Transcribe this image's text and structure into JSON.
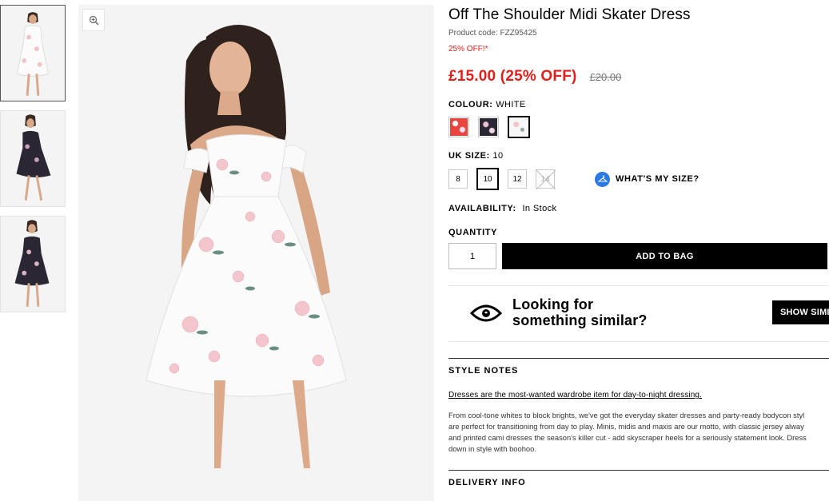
{
  "product": {
    "title": "Off The Shoulder Midi Skater Dress",
    "product_code": "Product code: FZZ95425",
    "discount_note": "25% OFF!*",
    "price_now": "£15.00 (25% OFF)",
    "price_was": "£20.00"
  },
  "colour": {
    "label": "COLOUR:",
    "value": "WHITE",
    "swatches": [
      {
        "name": "red-floral",
        "color": "#e8463c"
      },
      {
        "name": "black-floral",
        "color": "#2a2633"
      },
      {
        "name": "white-floral",
        "color": "#f2f2f2"
      }
    ],
    "selected_index": 2
  },
  "size": {
    "label": "UK SIZE:",
    "value": "10",
    "options": [
      "8",
      "10",
      "12",
      "14"
    ],
    "selected": "10",
    "out_of_stock": [
      "14"
    ],
    "guide_label": "WHAT'S MY SIZE?"
  },
  "availability": {
    "label": "AVAILABILITY:",
    "value": "In Stock"
  },
  "quantity": {
    "label": "QUANTITY",
    "value": "1"
  },
  "actions": {
    "add_to_bag": "ADD TO BAG"
  },
  "similar": {
    "line1": "Looking for",
    "line2": "something similar?",
    "button": "SHOW SIMI"
  },
  "style_notes": {
    "heading": "STYLE NOTES",
    "lead": "Dresses are the most-wanted wardrobe item for day-to-night dressing.",
    "body_lines": [
      "From cool-tone whites to block brights, we've got the everyday skater dresses and party-ready bodycon styl",
      "are perfect for transitioning from day to play. Minis, midis and maxis are our motto, with classic jersey alway",
      "and printed cami dresses the season's killer cut - add skyscraper heels for a seriously statement look. Dress",
      "down in style with boohoo."
    ]
  },
  "delivery": {
    "heading": "DELIVERY INFO"
  },
  "colors": {
    "accent_red": "#e0201d",
    "size_guide_blue": "#2a7ae2"
  }
}
